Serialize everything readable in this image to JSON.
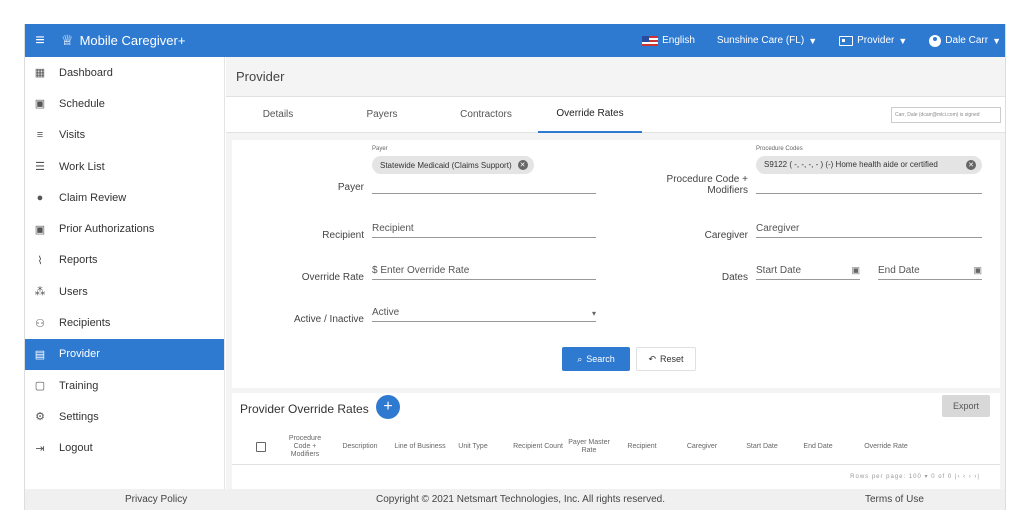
{
  "app": {
    "title": "Mobile Caregiver+",
    "hamburger_icon": "menu-icon",
    "logo_icon": "caregiver-logo-icon"
  },
  "topbar": {
    "language": "English",
    "organization": "Sunshine Care (FL)",
    "role": "Provider",
    "user": "Dale Carr"
  },
  "sidebar": {
    "items": [
      {
        "label": "Dashboard",
        "icon": "dashboard-icon",
        "glyph": "▦"
      },
      {
        "label": "Schedule",
        "icon": "calendar-icon",
        "glyph": "▣"
      },
      {
        "label": "Visits",
        "icon": "filter-icon",
        "glyph": "≡"
      },
      {
        "label": "Work List",
        "icon": "list-icon",
        "glyph": "☰"
      },
      {
        "label": "Claim Review",
        "icon": "alert-icon",
        "glyph": "●"
      },
      {
        "label": "Prior Authorizations",
        "icon": "calendar-check-icon",
        "glyph": "▣"
      },
      {
        "label": "Reports",
        "icon": "chart-line-icon",
        "glyph": "⌇"
      },
      {
        "label": "Users",
        "icon": "users-icon",
        "glyph": "⁂"
      },
      {
        "label": "Recipients",
        "icon": "recipients-icon",
        "glyph": "⚇"
      },
      {
        "label": "Provider",
        "icon": "provider-icon",
        "glyph": "▤"
      },
      {
        "label": "Training",
        "icon": "training-icon",
        "glyph": "▢"
      },
      {
        "label": "Settings",
        "icon": "gear-icon",
        "glyph": "⚙"
      },
      {
        "label": "Logout",
        "icon": "logout-icon",
        "glyph": "⇥"
      }
    ],
    "active": "Provider"
  },
  "page": {
    "title": "Provider"
  },
  "tabs": [
    "Details",
    "Payers",
    "Contractors",
    "Override Rates"
  ],
  "active_tab": "Override Rates",
  "tab_note": "Carr, Dale (dcarr@mlci.com) is signed",
  "form": {
    "payer_label": "Payer",
    "payer_small": "Payer",
    "payer_value": "Statewide Medicaid (Claims Support)",
    "proc_label_1": "Procedure Code +",
    "proc_label_2": "Modifiers",
    "proc_small": "Procedure Codes",
    "proc_value": "S9122 ( -, -, -, - ) (-) Home health aide or certified",
    "recipient_label": "Recipient",
    "recipient_placeholder": "Recipient",
    "caregiver_label": "Caregiver",
    "caregiver_placeholder": "Caregiver",
    "override_label": "Override Rate",
    "override_placeholder": "$ Enter Override Rate",
    "dates_label": "Dates",
    "start_placeholder": "Start Date",
    "end_placeholder": "End Date",
    "active_label": "Active / Inactive",
    "active_value": "Active",
    "search_label": "Search",
    "reset_label": "Reset"
  },
  "rates": {
    "title": "Provider Override Rates",
    "export_label": "Export",
    "columns": [
      "Procedure Code + Modifiers",
      "Description",
      "Line of Business",
      "Unit Type",
      "Recipient Count",
      "Payer Master Rate",
      "Recipient",
      "Caregiver",
      "Start Date",
      "End Date",
      "Override Rate"
    ],
    "pager": "Rows per page: 100 ▾   0 of 0   |‹  ‹  ›  ›|"
  },
  "footer": {
    "privacy": "Privacy Policy",
    "copyright": "Copyright © 2021 Netsmart Technologies, Inc. All rights reserved.",
    "terms": "Terms of Use"
  }
}
